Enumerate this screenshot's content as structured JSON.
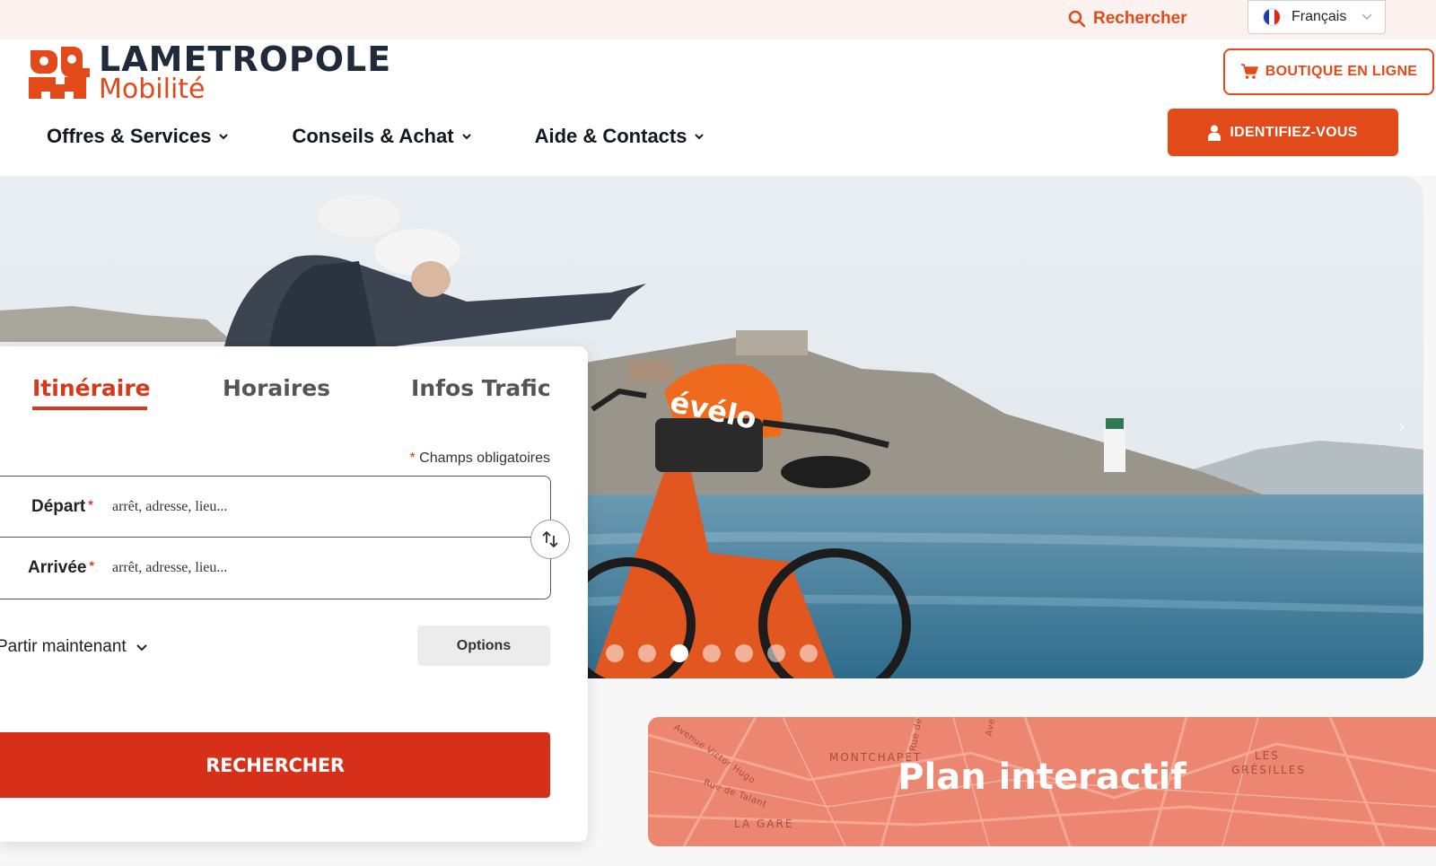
{
  "topbar": {
    "search_label": "Rechercher",
    "language": "Français"
  },
  "header": {
    "logo_top": "LAMETROPOLE",
    "logo_bottom": "Mobilité",
    "shop_label": "BOUTIQUE EN LIGNE",
    "login_label": "IDENTIFIEZ-VOUS",
    "nav": [
      {
        "label": "Offres & Services"
      },
      {
        "label": "Conseils & Achat"
      },
      {
        "label": "Aide & Contacts"
      }
    ]
  },
  "hero": {
    "slides_count": 7,
    "active_slide": 3
  },
  "planner": {
    "tabs": [
      "Itinéraire",
      "Horaires",
      "Infos Trafic"
    ],
    "active_tab": "Itinéraire",
    "required_note": "Champs obligatoires",
    "required_marker": "*",
    "departure_label": "Départ",
    "departure_placeholder": "arrêt, adresse, lieu...",
    "arrival_label": "Arrivée",
    "arrival_placeholder": "arrêt, adresse, lieu...",
    "time_select": "Partir maintenant",
    "options_label": "Options",
    "submit_label": "RECHERCHER"
  },
  "map_banner": {
    "title": "Plan interactif",
    "labels": [
      "MONTCHAPET",
      "LES",
      "GRÉSILLES",
      "LA GARE",
      "Avenue Victor Hugo",
      "Rue de Talant",
      "Rue de",
      "Ave"
    ]
  },
  "colors": {
    "accent": "#e24a1a",
    "accent_dark": "#d7301a",
    "map_bg": "#ec8670"
  }
}
